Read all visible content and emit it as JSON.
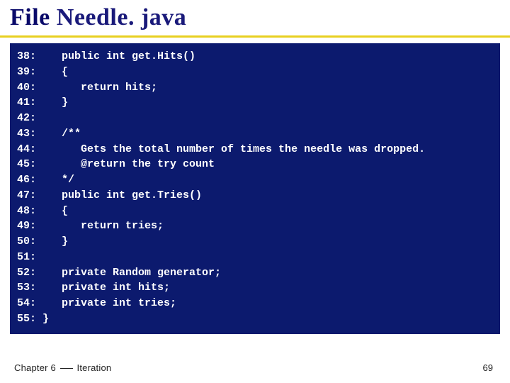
{
  "title": {
    "accent": "File",
    "rest": " Needle. java"
  },
  "code": {
    "first_line": 38,
    "lines": [
      "   public int get.Hits()",
      "   {",
      "      return hits;",
      "   }",
      "",
      "   /**",
      "      Gets the total number of times the needle was dropped.",
      "      @return the try count",
      "   */",
      "   public int get.Tries()",
      "   {",
      "      return tries;",
      "   }",
      "",
      "   private Random generator;",
      "   private int hits;",
      "   private int tries;",
      "}"
    ]
  },
  "footer": {
    "chapter_left": "Chapter 6",
    "chapter_right": "Iteration",
    "page": "69"
  }
}
